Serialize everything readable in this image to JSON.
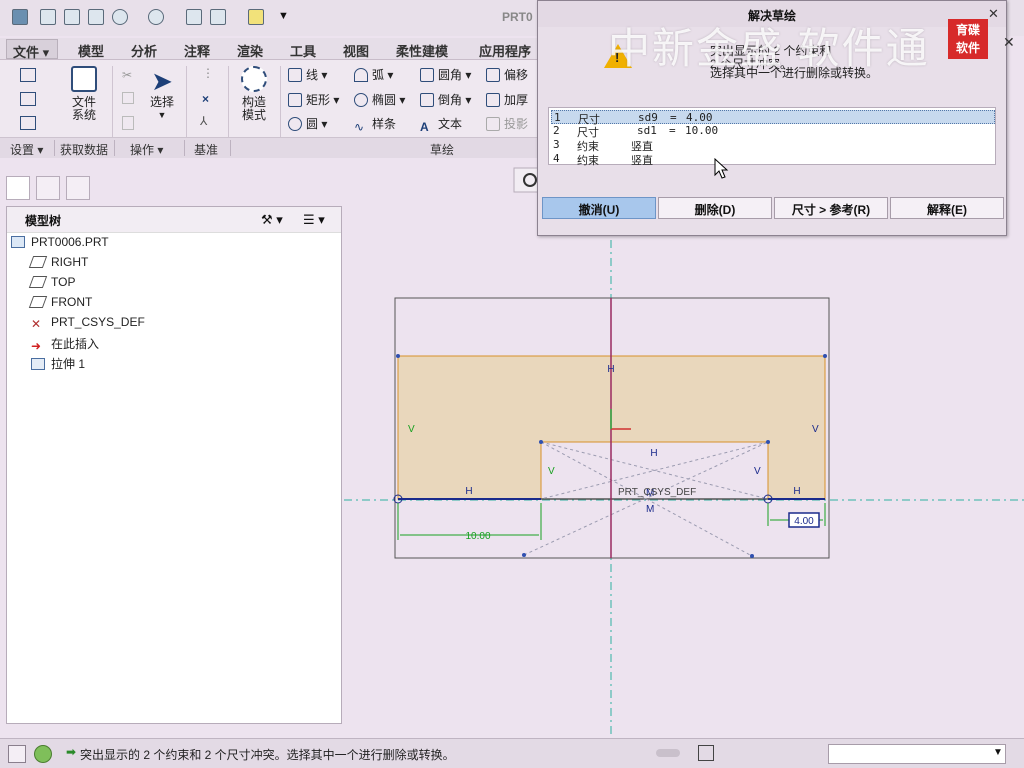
{
  "window": {
    "title": "PRT0"
  },
  "menubar": {
    "items": [
      "文件",
      "模型",
      "分析",
      "注释",
      "渲染",
      "工具",
      "视图",
      "柔性建模",
      "应用程序"
    ]
  },
  "ribbon": {
    "setup": {
      "file_system": "文件\n系统"
    },
    "operations": {
      "select": "选择"
    },
    "construct": {
      "construct_mode": "构造\n模式"
    },
    "sketch_tools": {
      "line": "线",
      "rectangle": "矩形",
      "circle": "圆",
      "arc": "弧",
      "ellipse": "椭圆",
      "spline": "样条",
      "fillet": "圆角",
      "chamfer": "倒角",
      "text": "文本",
      "offset": "偏移",
      "thicken": "加厚",
      "project": "投影"
    },
    "groups": {
      "settings": "设置",
      "get_data": "获取数据",
      "operations": "操作",
      "datum": "基准",
      "sketch": "草绘"
    }
  },
  "model_tree": {
    "title": "模型树",
    "items": [
      {
        "label": "PRT0006.PRT",
        "icon": "part-icon"
      },
      {
        "label": "RIGHT",
        "icon": "datum-plane-icon"
      },
      {
        "label": "TOP",
        "icon": "datum-plane-icon"
      },
      {
        "label": "FRONT",
        "icon": "datum-plane-icon"
      },
      {
        "label": "PRT_CSYS_DEF",
        "icon": "csys-icon"
      },
      {
        "label": "在此插入",
        "icon": "insert-arrow-icon"
      },
      {
        "label": "拉伸 1",
        "icon": "extrude-icon"
      }
    ]
  },
  "dialog": {
    "title": "解决草绘",
    "message": [
      "突出显示的 2 个约束和",
      "2 个尺寸冲突。",
      "选择其中一个进行删除或转换。"
    ],
    "watermark": "中新金盛 软件通",
    "logo_text": [
      "育碟",
      "软件"
    ],
    "conflicts": [
      {
        "n": "1",
        "type": "尺寸",
        "name": "sd9",
        "eq": "=",
        "val": "4.00"
      },
      {
        "n": "2",
        "type": "尺寸",
        "name": "sd1",
        "eq": "=",
        "val": "10.00"
      },
      {
        "n": "3",
        "type": "约束",
        "name": "竖直",
        "eq": "",
        "val": ""
      },
      {
        "n": "4",
        "type": "约束",
        "name": "竖直",
        "eq": "",
        "val": ""
      }
    ],
    "buttons": {
      "undo": "撤消(U)",
      "delete": "删除(D)",
      "to_ref": "尺寸 > 参考(R)",
      "explain": "解释(E)"
    }
  },
  "sketch": {
    "dim_left": "10.00",
    "dim_right": "4.00",
    "csys_label": "PRT_CSYS_DEF",
    "constraint_marks": {
      "h": "H",
      "v": "V",
      "m": "M"
    }
  },
  "status": {
    "message": "突出显示的 2 个约束和 2 个尺寸冲突。选择其中一个进行删除或转换。"
  },
  "colors": {
    "accent": "#a8c7ec",
    "sketch_fill": "#e9d7bc",
    "sketch_edge": "#d8902a",
    "dim_green": "#18a020"
  }
}
